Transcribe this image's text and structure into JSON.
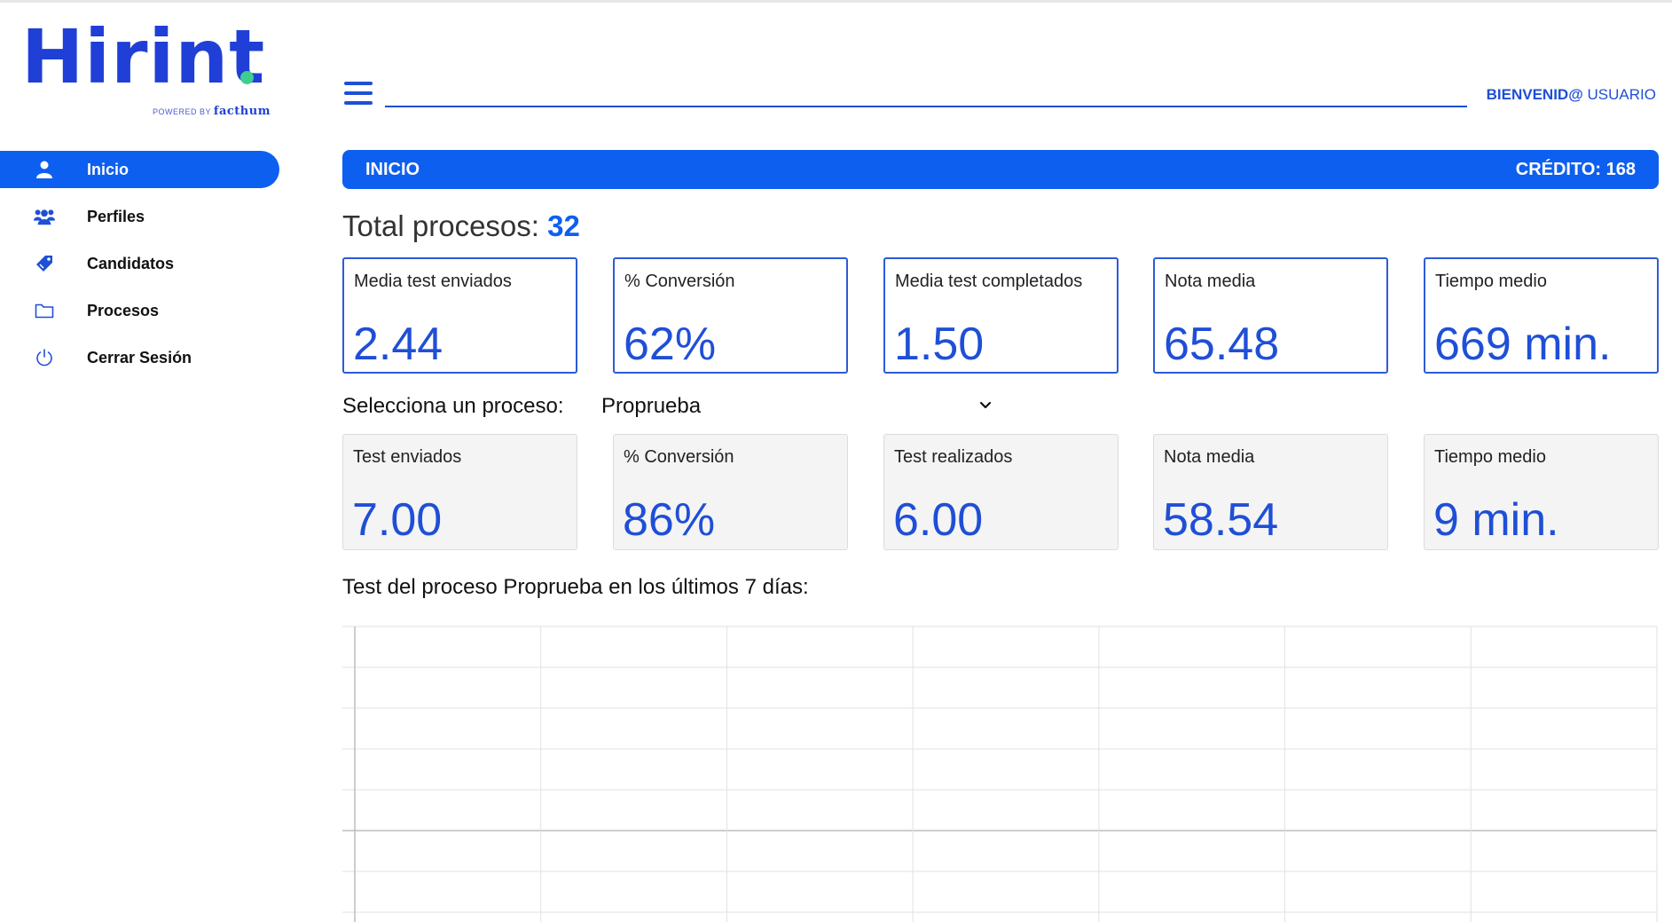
{
  "logo": {
    "word": "Hirint",
    "powered_by": "POWERED BY",
    "brand": "facthum"
  },
  "sidebar": {
    "items": [
      {
        "label": "Inicio",
        "icon": "user-icon",
        "active": true
      },
      {
        "label": "Perfiles",
        "icon": "users-icon",
        "active": false
      },
      {
        "label": "Candidatos",
        "icon": "tag-icon",
        "active": false
      },
      {
        "label": "Procesos",
        "icon": "folder-icon",
        "active": false
      },
      {
        "label": "Cerrar Sesión",
        "icon": "power-icon",
        "active": false
      }
    ]
  },
  "header": {
    "welcome_bold": "BIENVENID@",
    "welcome_user": "USUARIO"
  },
  "titlebar": {
    "title": "INICIO",
    "credit": "CRÉDITO: 168"
  },
  "summary": {
    "label": "Total procesos:",
    "value": "32"
  },
  "global_stats": [
    {
      "label": "Media test enviados",
      "value": "2.44"
    },
    {
      "label": "% Conversión",
      "value": "62%"
    },
    {
      "label": "Media test completados",
      "value": "1.50"
    },
    {
      "label": "Nota media",
      "value": "65.48"
    },
    {
      "label": "Tiempo medio",
      "value": "669 min."
    }
  ],
  "process_select": {
    "label": "Selecciona un proceso:",
    "selected": "Proprueba"
  },
  "process_stats": [
    {
      "label": "Test enviados",
      "value": "7.00"
    },
    {
      "label": "% Conversión",
      "value": "86%"
    },
    {
      "label": "Test realizados",
      "value": "6.00"
    },
    {
      "label": "Nota media",
      "value": "58.54"
    },
    {
      "label": "Tiempo medio",
      "value": "9 min."
    }
  ],
  "chart_section": {
    "title": "Test del proceso Proprueba en los últimos 7 días:"
  },
  "chart_data": {
    "type": "line",
    "title": "",
    "categories": [],
    "series": [],
    "grid": true,
    "vertical_gridlines": 8,
    "horizontal_gridlines": 8
  },
  "colors": {
    "primary": "#0d5ff0",
    "accent_text": "#1f4fd6",
    "logo_dot": "#3ecf8e"
  }
}
